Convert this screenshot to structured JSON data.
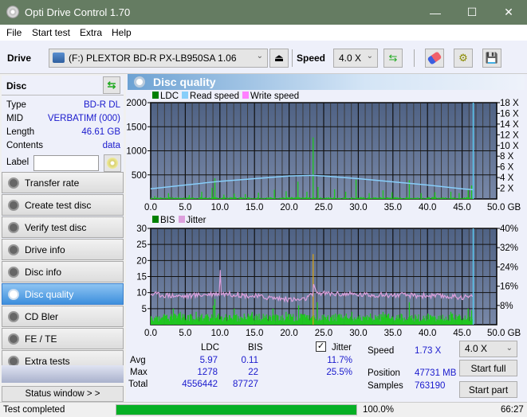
{
  "window": {
    "title": "Opti Drive Control 1.70",
    "minimize": "—",
    "maximize": "☐",
    "close": "✕"
  },
  "menu": [
    "File",
    "Start test",
    "Extra",
    "Help"
  ],
  "toolbar": {
    "drive_label": "Drive",
    "drive_value": "(F:)  PLEXTOR BD-R  PX-LB950SA 1.06",
    "speed_label": "Speed",
    "speed_value": "4.0 X",
    "icons": [
      "eject-icon",
      "refresh-icon",
      "erase-icon",
      "settings-icon",
      "save-icon"
    ]
  },
  "disc": {
    "header": "Disc",
    "rows": [
      {
        "k": "Type",
        "v": "BD-R DL"
      },
      {
        "k": "MID",
        "v": "VERBATIMf (000)"
      },
      {
        "k": "Length",
        "v": "46.61 GB"
      },
      {
        "k": "Contents",
        "v": "data"
      }
    ],
    "label_key": "Label",
    "label_value": ""
  },
  "nav": [
    {
      "label": "Transfer rate",
      "active": false
    },
    {
      "label": "Create test disc",
      "active": false
    },
    {
      "label": "Verify test disc",
      "active": false
    },
    {
      "label": "Drive info",
      "active": false
    },
    {
      "label": "Disc info",
      "active": false
    },
    {
      "label": "Disc quality",
      "active": true
    },
    {
      "label": "CD Bler",
      "active": false
    },
    {
      "label": "FE / TE",
      "active": false
    },
    {
      "label": "Extra tests",
      "active": false
    }
  ],
  "status_window_btn": "Status window > >",
  "panel_title": "Disc quality",
  "chart_data": [
    {
      "type": "bar",
      "title": "LDC / Read speed",
      "legend": [
        {
          "name": "LDC",
          "color": "#008000"
        },
        {
          "name": "Read speed",
          "color": "#87cefa"
        },
        {
          "name": "Write speed",
          "color": "#ff80ff"
        }
      ],
      "xlabel": "GB",
      "xlim": [
        0,
        50
      ],
      "x_ticks": [
        "0.0",
        "5.0",
        "10.0",
        "15.0",
        "20.0",
        "25.0",
        "30.0",
        "35.0",
        "40.0",
        "45.0",
        "50.0 GB"
      ],
      "ylim": [
        0,
        2000
      ],
      "y_ticks": [
        "500",
        "1000",
        "1500",
        "2000"
      ],
      "y2lim": [
        0,
        18
      ],
      "y2_ticks": [
        "2 X",
        "4 X",
        "6 X",
        "8 X",
        "10 X",
        "12 X",
        "14 X",
        "16 X",
        "18 X"
      ],
      "end_marker_gb": 46.61,
      "ldc_spikes": [
        [
          0.5,
          60
        ],
        [
          2.5,
          120
        ],
        [
          5.5,
          80
        ],
        [
          7.3,
          150
        ],
        [
          8.8,
          230
        ],
        [
          9.2,
          430
        ],
        [
          10.5,
          90
        ],
        [
          12,
          110
        ],
        [
          13.6,
          100
        ],
        [
          15.5,
          130
        ],
        [
          17.8,
          190
        ],
        [
          19.5,
          160
        ],
        [
          21.2,
          360
        ],
        [
          22.5,
          150
        ],
        [
          23.4,
          1278
        ],
        [
          24.1,
          250
        ],
        [
          26.5,
          200
        ],
        [
          28.1,
          150
        ],
        [
          29.6,
          400
        ],
        [
          31.5,
          120
        ],
        [
          33.5,
          180
        ],
        [
          34.8,
          140
        ],
        [
          37.3,
          390
        ],
        [
          39,
          120
        ],
        [
          41,
          140
        ],
        [
          43.3,
          150
        ],
        [
          44.5,
          120
        ],
        [
          45.8,
          200
        ],
        [
          46.3,
          280
        ]
      ],
      "read_speed": [
        [
          0,
          1.9
        ],
        [
          5,
          2.6
        ],
        [
          10,
          3.3
        ],
        [
          15,
          3.8
        ],
        [
          20,
          4.3
        ],
        [
          23.4,
          4.4
        ],
        [
          25,
          4.3
        ],
        [
          30,
          3.8
        ],
        [
          35,
          3.2
        ],
        [
          40,
          2.6
        ],
        [
          45,
          1.9
        ],
        [
          46.6,
          1.73
        ]
      ]
    },
    {
      "type": "bar",
      "title": "BIS / Jitter",
      "legend": [
        {
          "name": "BIS",
          "color": "#008000"
        },
        {
          "name": "Jitter",
          "color": "#dda0dd"
        }
      ],
      "xlabel": "GB",
      "xlim": [
        0,
        50
      ],
      "x_ticks": [
        "0.0",
        "5.0",
        "10.0",
        "15.0",
        "20.0",
        "25.0",
        "30.0",
        "35.0",
        "40.0",
        "45.0",
        "50.0 GB"
      ],
      "ylim": [
        0,
        30
      ],
      "y_ticks": [
        "5",
        "10",
        "15",
        "20",
        "25",
        "30"
      ],
      "y2lim": [
        0,
        40
      ],
      "y2_ticks": [
        "8%",
        "16%",
        "24%",
        "32%",
        "40%"
      ],
      "end_marker_gb": 46.61,
      "bis_spikes": [
        [
          3.2,
          5
        ],
        [
          4.2,
          4
        ],
        [
          6.5,
          4
        ],
        [
          9,
          6
        ],
        [
          9.2,
          8
        ],
        [
          12,
          5
        ],
        [
          14.6,
          4
        ],
        [
          17.6,
          5
        ],
        [
          19.5,
          4
        ],
        [
          21.3,
          6
        ],
        [
          23.4,
          22
        ],
        [
          24,
          7
        ],
        [
          29,
          4
        ],
        [
          33.5,
          4
        ],
        [
          37.3,
          7
        ],
        [
          40,
          3.5
        ],
        [
          43.3,
          4
        ],
        [
          45.8,
          5
        ],
        [
          46.3,
          4.5
        ]
      ],
      "jitter_pct": [
        [
          0,
          12.8
        ],
        [
          2.5,
          12.2
        ],
        [
          5,
          11.8
        ],
        [
          7.5,
          12.5
        ],
        [
          9.9,
          13
        ],
        [
          10,
          25.5
        ],
        [
          10.2,
          13
        ],
        [
          12.5,
          12.5
        ],
        [
          15,
          11.8
        ],
        [
          17.5,
          11.2
        ],
        [
          20,
          10.5
        ],
        [
          22,
          10.3
        ],
        [
          23.4,
          12.4
        ],
        [
          23.5,
          17
        ],
        [
          23.8,
          13.5
        ],
        [
          25,
          13
        ],
        [
          30,
          12.5
        ],
        [
          35,
          12.3
        ],
        [
          40,
          12
        ],
        [
          45,
          11.5
        ],
        [
          46.6,
          11.5
        ]
      ]
    }
  ],
  "stats": {
    "col_ldc": "LDC",
    "col_bis": "BIS",
    "jitter_label": "Jitter",
    "jitter_checked": true,
    "rows": [
      {
        "k": "Avg",
        "ldc": "5.97",
        "bis": "0.11",
        "jitter": "11.7%"
      },
      {
        "k": "Max",
        "ldc": "1278",
        "bis": "22",
        "jitter": "25.5%"
      },
      {
        "k": "Total",
        "ldc": "4556442",
        "bis": "87727",
        "jitter": ""
      }
    ],
    "speed_label": "Speed",
    "speed_value": "1.73 X",
    "position_label": "Position",
    "position_value": "47731 MB",
    "samples_label": "Samples",
    "samples_value": "763190",
    "speed_select": "4.0 X",
    "start_full": "Start full",
    "start_part": "Start part"
  },
  "statusbar": {
    "text": "Test completed",
    "progress_pct": 100,
    "progress_text": "100.0%",
    "time": "66:27"
  }
}
